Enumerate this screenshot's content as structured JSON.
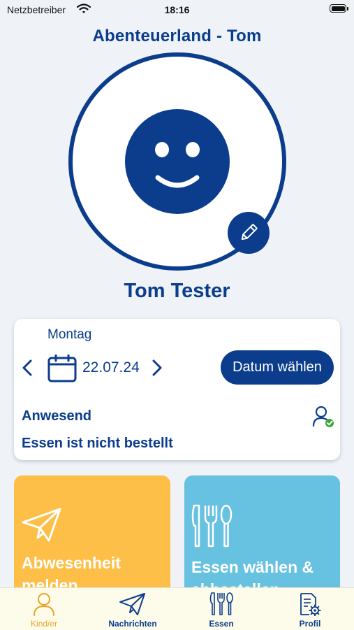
{
  "status_bar": {
    "carrier": "Netzbetreiber",
    "time": "18:16"
  },
  "header": {
    "title": "Abenteuerland - Tom"
  },
  "profile": {
    "name": "Tom Tester"
  },
  "day": {
    "weekday": "Montag",
    "date": "22.07.24",
    "pick_date_label": "Datum wählen",
    "attendance": "Anwesend",
    "meal_status": "Essen ist nicht bestellt"
  },
  "tiles": {
    "absence_label": "Abwesenheit melden",
    "meal_label": "Essen wählen & abbestellen"
  },
  "tabbar": {
    "items": [
      {
        "label": "Kind/er",
        "icon": "person-icon",
        "active": true
      },
      {
        "label": "Nachrichten",
        "icon": "paper-plane-icon",
        "active": false
      },
      {
        "label": "Essen",
        "icon": "cutlery-icon",
        "active": false
      },
      {
        "label": "Profil",
        "icon": "document-gear-icon",
        "active": false
      }
    ]
  },
  "colors": {
    "primary": "#0b3d8c",
    "background": "#eff3f8",
    "absence_tile": "#fdbf47",
    "meal_tile": "#67c1e0",
    "active_tab": "#e9a528",
    "present_check": "#3aa63a"
  }
}
